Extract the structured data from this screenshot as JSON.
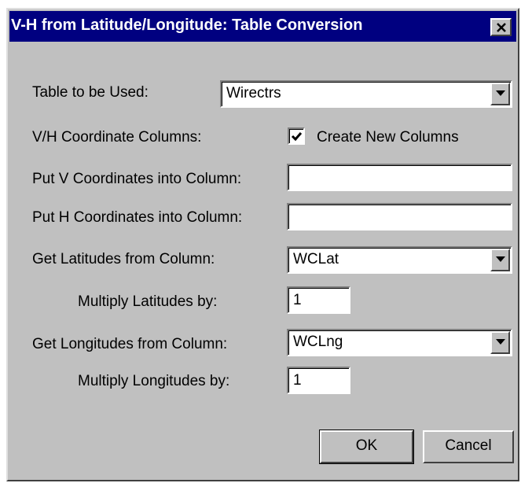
{
  "dialog": {
    "title": "V-H from Latitude/Longitude: Table Conversion"
  },
  "form": {
    "table_label": "Table to be Used:",
    "table_value": "Wirectrs",
    "vh_columns_label": "V/H Coordinate Columns:",
    "create_new_columns_label": "Create New Columns",
    "create_new_columns_checked": true,
    "v_column_label": "Put V Coordinates into Column:",
    "v_column_value": "",
    "h_column_label": "Put H Coordinates into Column:",
    "h_column_value": "",
    "lat_column_label": "Get Latitudes from Column:",
    "lat_column_value": "WCLat",
    "lat_multiplier_label": "Multiply Latitudes by:",
    "lat_multiplier_value": "1",
    "lng_column_label": "Get Longitudes from Column:",
    "lng_column_value": "WCLng",
    "lng_multiplier_label": "Multiply Longitudes by:",
    "lng_multiplier_value": "1"
  },
  "buttons": {
    "ok_label": "OK",
    "cancel_label": "Cancel"
  },
  "colors": {
    "titlebar": "#000080",
    "dialog_face": "#c0c0c0"
  }
}
